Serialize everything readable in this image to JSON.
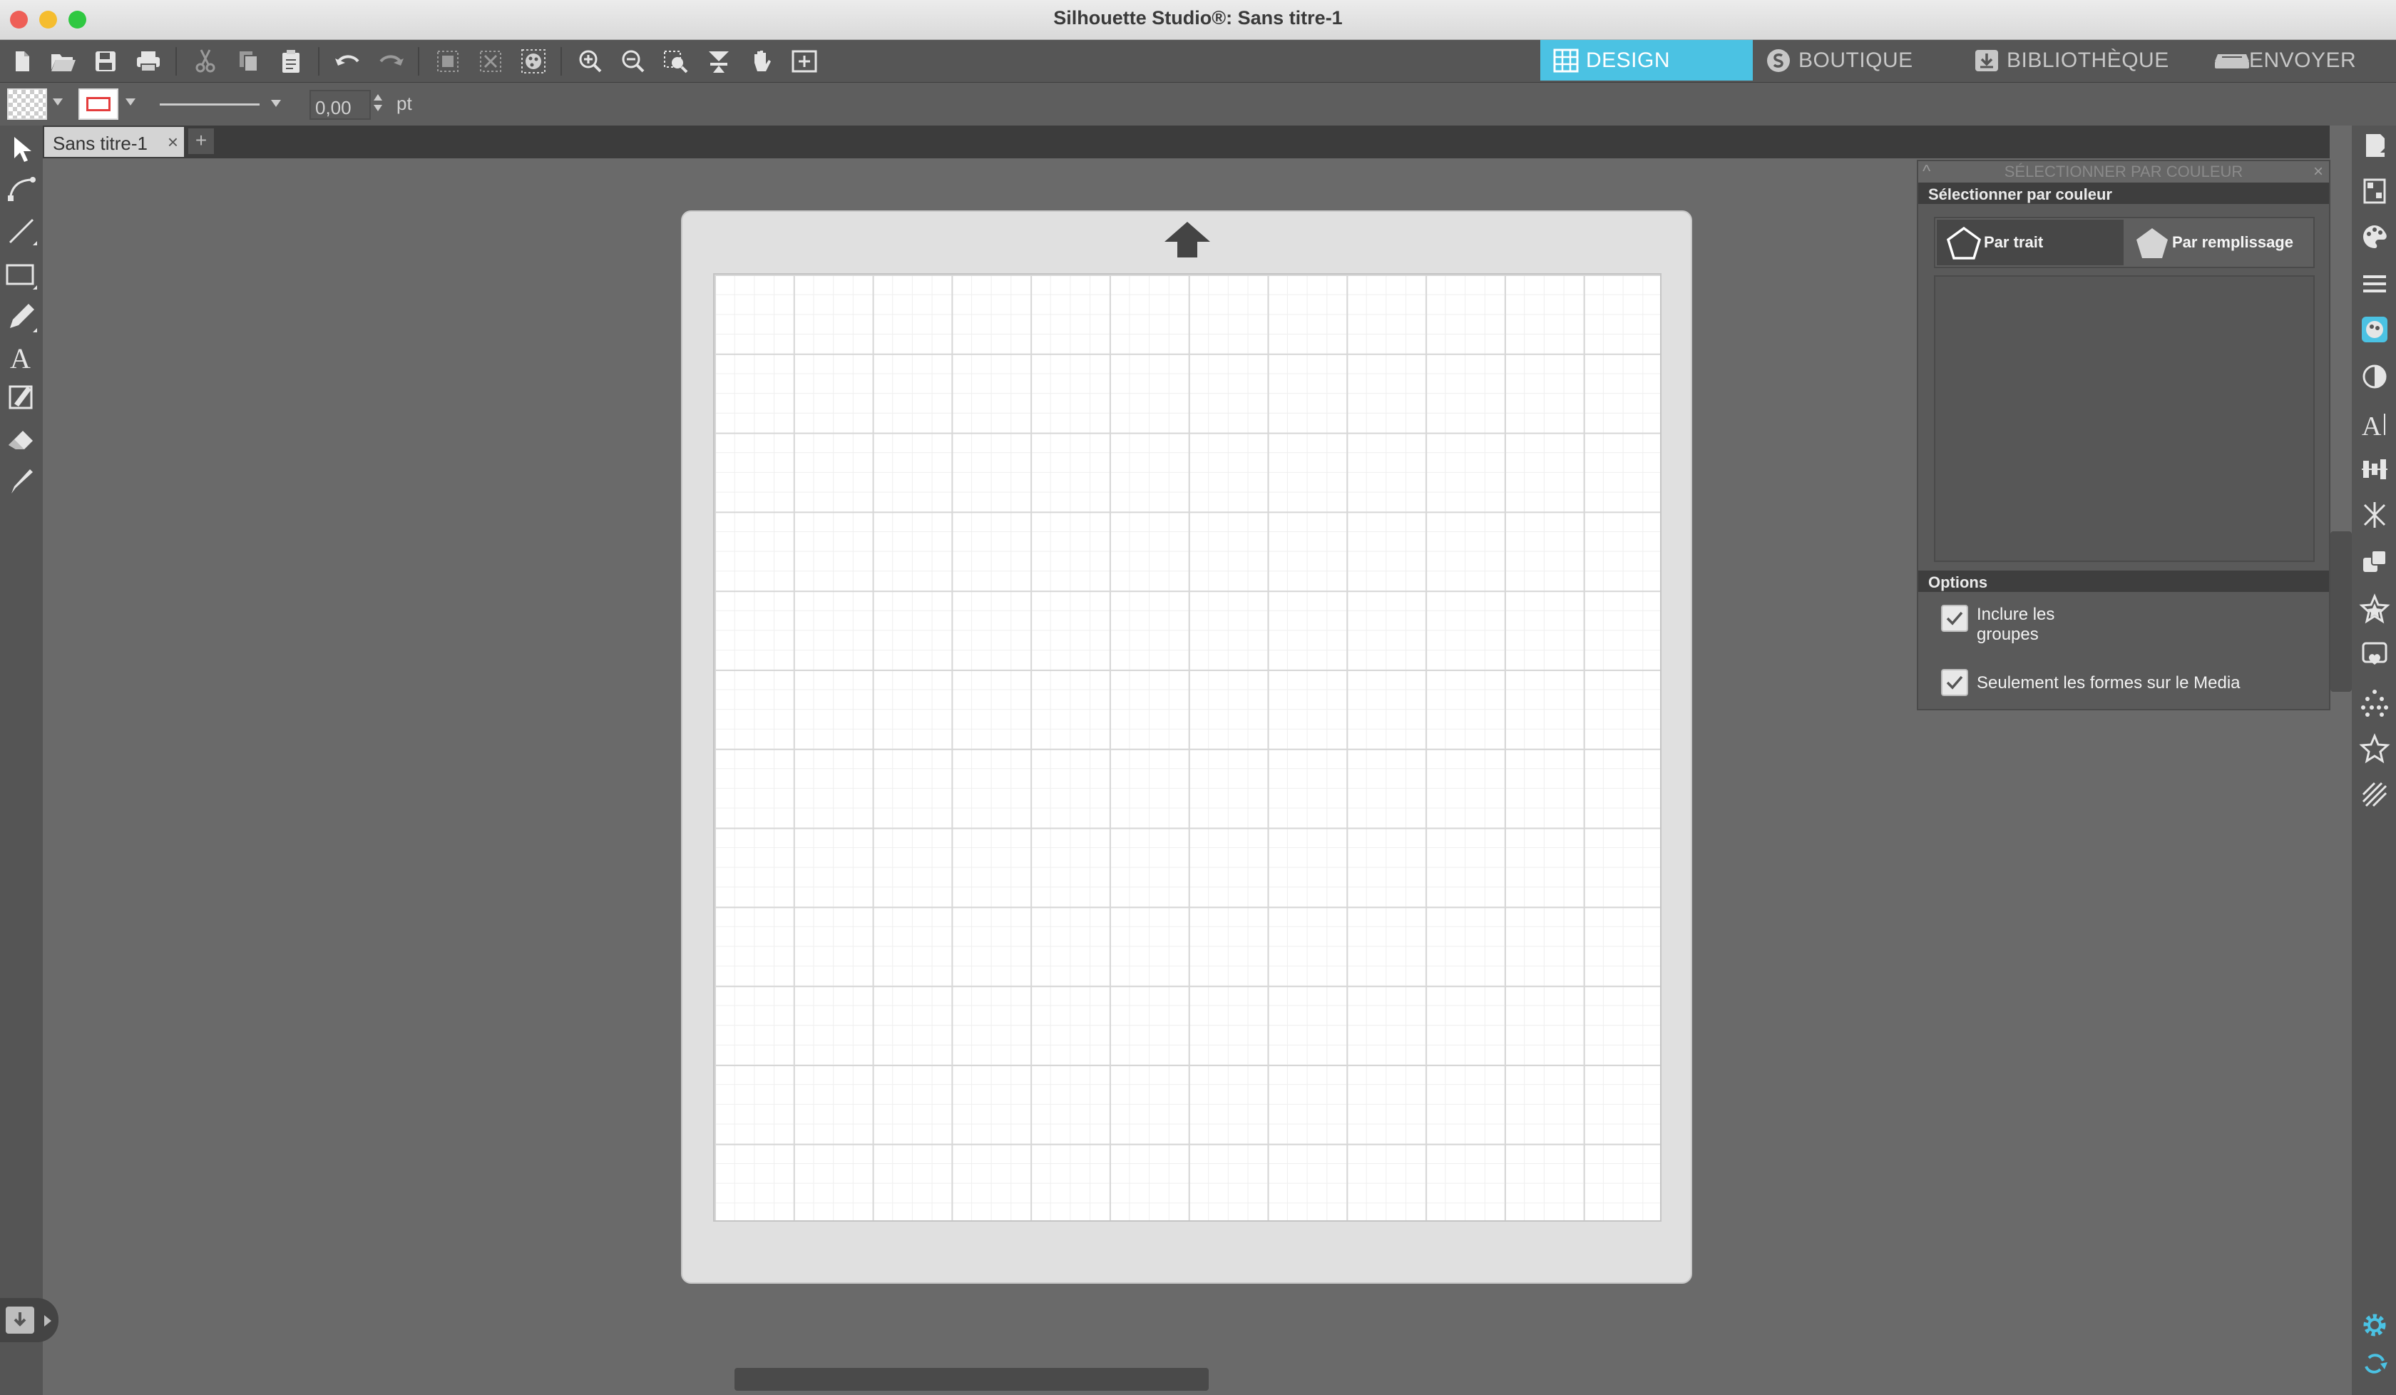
{
  "window": {
    "title": "Silhouette Studio®: Sans titre-1"
  },
  "toolbar": {
    "nav_tabs": [
      {
        "label": "DESIGN",
        "icon": "grid-icon",
        "active": true
      },
      {
        "label": "BOUTIQUE",
        "icon": "store-s-icon",
        "active": false
      },
      {
        "label": "BIBLIOTHÈQUE",
        "icon": "download-library-icon",
        "active": false
      },
      {
        "label": "ENVOYER",
        "icon": "send-cutter-icon",
        "active": false
      }
    ],
    "accent_color": "#4bc2e3"
  },
  "props": {
    "line_width_value": "0,00",
    "line_width_unit": "pt"
  },
  "document_tabs": [
    {
      "label": "Sans titre-1",
      "close": "×"
    }
  ],
  "document_add": "+",
  "panel": {
    "header_title": "SÉLECTIONNER PAR COULEUR",
    "section_title": "Sélectionner par couleur",
    "mode_stroke": "Par trait",
    "mode_fill": "Par remplissage",
    "options_title": "Options",
    "option_include_groups_line1": "Inclure les",
    "option_include_groups_line2": "groupes",
    "option_include_groups_checked": true,
    "option_media_only": "Seulement les formes sur le Media",
    "option_media_only_checked": true,
    "close": "×",
    "collapse": "^"
  }
}
